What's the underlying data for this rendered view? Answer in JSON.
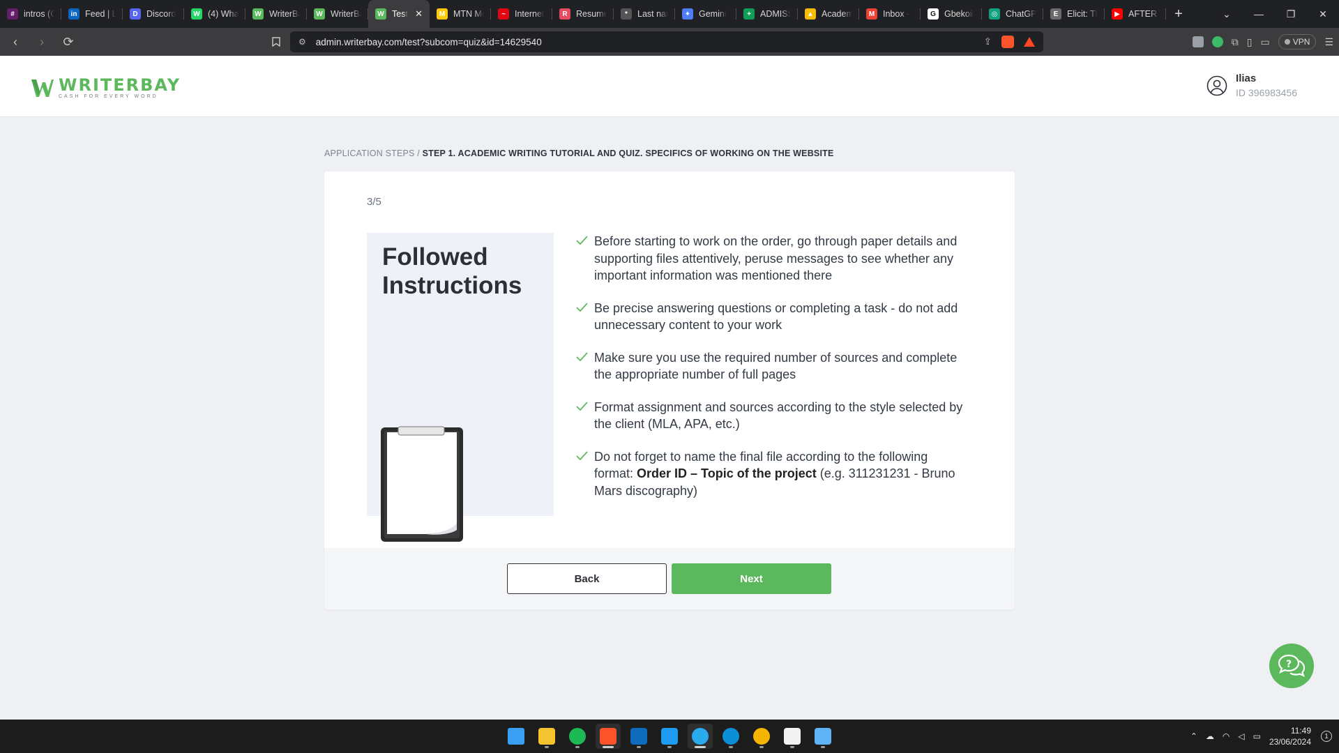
{
  "browser": {
    "tabs": [
      {
        "title": "intros (C",
        "color": "#611f69",
        "glyph": "#"
      },
      {
        "title": "Feed | Li",
        "color": "#0a66c2",
        "glyph": "in"
      },
      {
        "title": "Discord",
        "color": "#5865f2",
        "glyph": "D"
      },
      {
        "title": "(4) Wha",
        "color": "#25d366",
        "glyph": "W"
      },
      {
        "title": "WriterBa",
        "color": "#5cb85c",
        "glyph": "W"
      },
      {
        "title": "WriterBa",
        "color": "#5cb85c",
        "glyph": "W"
      },
      {
        "title": "Test",
        "color": "#5cb85c",
        "glyph": "W",
        "active": true
      },
      {
        "title": "MTN Mo",
        "color": "#ffcb05",
        "glyph": "M"
      },
      {
        "title": "Internet",
        "color": "#e30613",
        "glyph": "~"
      },
      {
        "title": "Resume",
        "color": "#e84a5f",
        "glyph": "R"
      },
      {
        "title": "Last nam",
        "color": "#555555",
        "glyph": "*"
      },
      {
        "title": "Gemini",
        "color": "#4f7cf7",
        "glyph": "✦"
      },
      {
        "title": "ADMISS",
        "color": "#0f9d58",
        "glyph": "+"
      },
      {
        "title": "Academ",
        "color": "#fbbc04",
        "glyph": "▲"
      },
      {
        "title": "Inbox -",
        "color": "#ea4335",
        "glyph": "M"
      },
      {
        "title": "Gbekoil",
        "color": "#ffffff",
        "glyph": "G"
      },
      {
        "title": "ChatGP",
        "color": "#10a37f",
        "glyph": "◎"
      },
      {
        "title": "Elicit: Th",
        "color": "#6b6b6b",
        "glyph": "E"
      },
      {
        "title": "AFTER S",
        "color": "#ff0000",
        "glyph": "▶"
      }
    ],
    "new_tab": "+",
    "url": "admin.writerbay.com/test?subcom=quiz&id=14629540",
    "vpn_label": "VPN"
  },
  "site": {
    "logo_name": "WRITERBAY",
    "logo_tagline": "CASH FOR EVERY WORD",
    "user_name": "Ilias",
    "user_id": "ID 396983456",
    "brand_color": "#5cb85c"
  },
  "breadcrumb": {
    "root": "APPLICATION STEPS",
    "separator": " / ",
    "current": "STEP 1. ACADEMIC WRITING TUTORIAL AND QUIZ. SPECIFICS OF WORKING ON THE WEBSITE"
  },
  "quiz": {
    "step_counter": "3/5",
    "hero_title_line1": "Followed",
    "hero_title_line2": "Instructions",
    "items": [
      "Before starting to work on the order, go through paper details and supporting files attentively, peruse messages to see whether any important information was mentioned there",
      "Be precise answering questions or completing a task - do not add unnecessary content to your work",
      "Make sure you use the required number of sources and complete the appropriate number of full pages",
      "Format assignment and sources according to the style selected by the client (MLA, APA, etc.)",
      "Do not forget to name the final file according to the following format:"
    ],
    "item5_bold": "Order ID – Topic of the project",
    "item5_rest": " (e.g. 311231231 - Bruno Mars discography)",
    "back_label": "Back",
    "next_label": "Next"
  },
  "taskbar": {
    "apps": [
      {
        "name": "start",
        "color": "#3aa0f3"
      },
      {
        "name": "file-explorer",
        "color": "#f4c430"
      },
      {
        "name": "spotify",
        "color": "#1db954"
      },
      {
        "name": "brave",
        "color": "#fb542b",
        "active": true
      },
      {
        "name": "outlook",
        "color": "#0f6cbd"
      },
      {
        "name": "vscode",
        "color": "#1f9cf0"
      },
      {
        "name": "telegram",
        "color": "#2aabee",
        "active": true
      },
      {
        "name": "edge",
        "color": "#0c8fd6"
      },
      {
        "name": "chrome",
        "color": "#f4b400"
      },
      {
        "name": "notion",
        "color": "#f2f2f2"
      },
      {
        "name": "notepad",
        "color": "#5fb4f5"
      }
    ],
    "time": "11:49",
    "date": "23/06/2024",
    "notification_count": "1"
  }
}
